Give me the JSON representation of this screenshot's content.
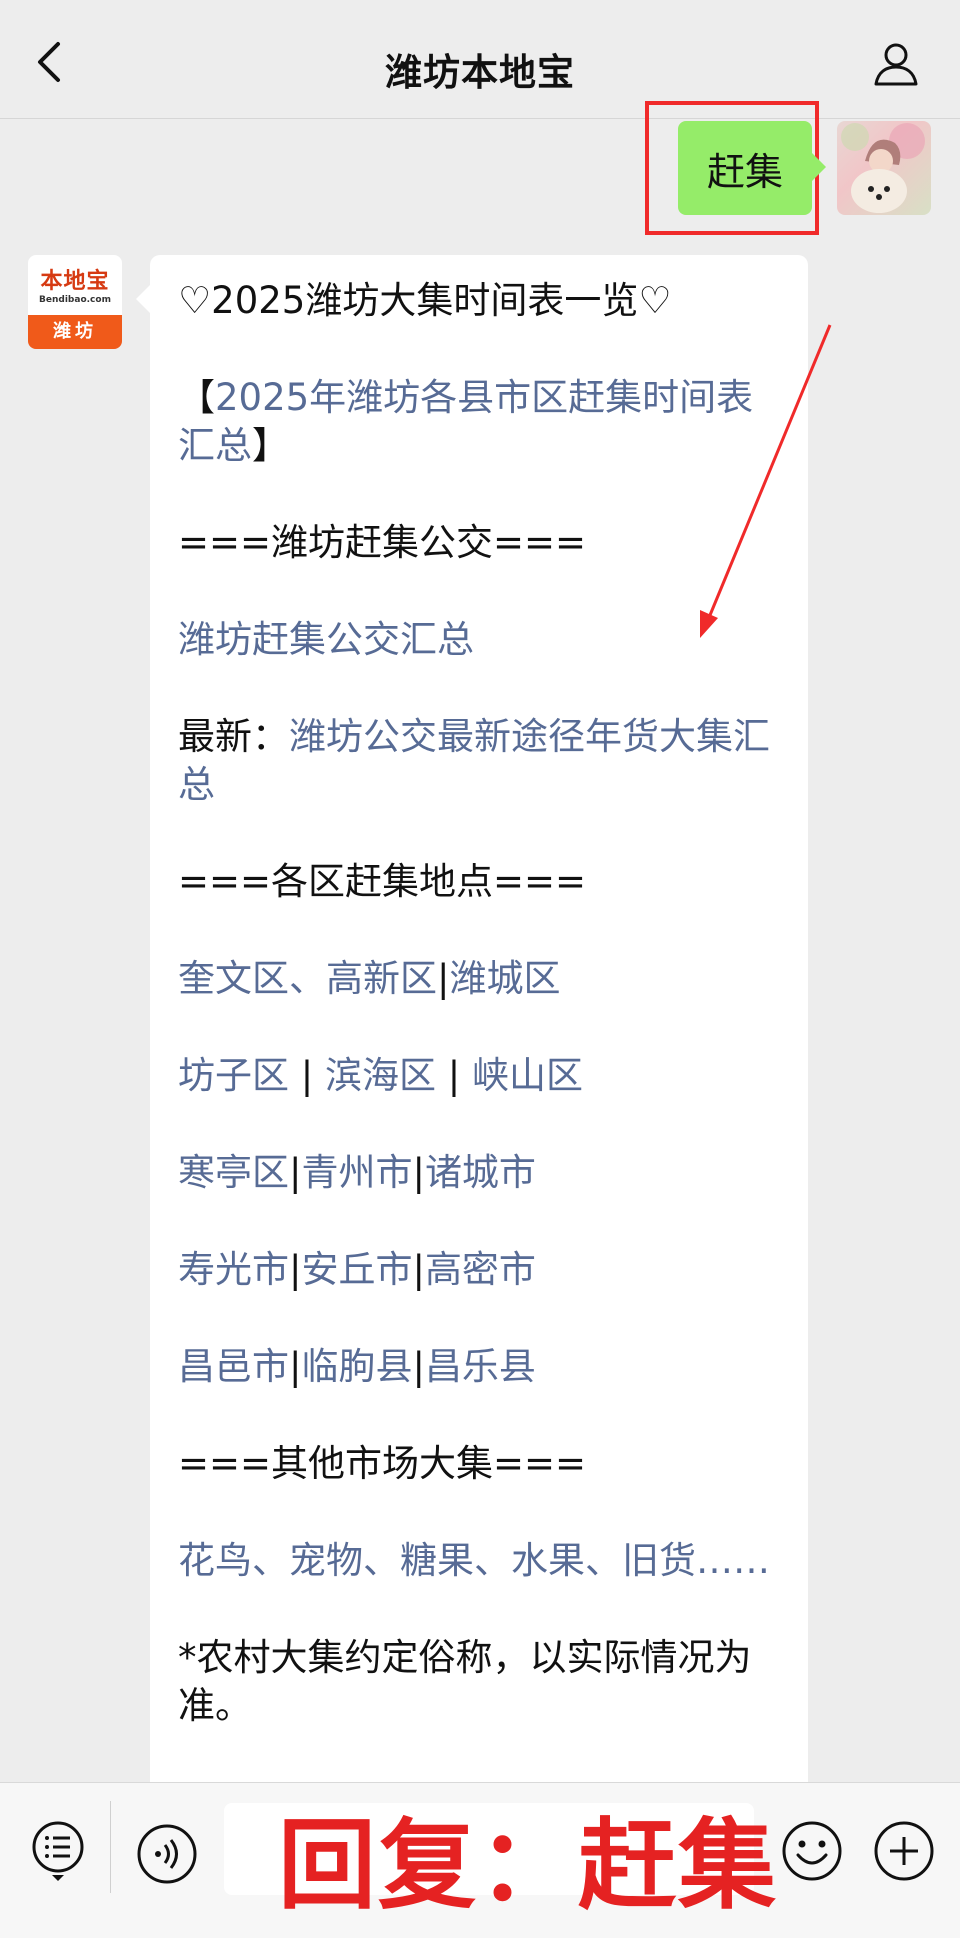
{
  "header": {
    "title": "潍坊本地宝",
    "back_icon": "chevron-left-icon",
    "profile_icon": "user-icon"
  },
  "user_message": {
    "text": "赶集"
  },
  "bot_avatar": {
    "logo_text": "本地宝",
    "domain": "Bendibao.com",
    "city": "潍坊"
  },
  "bot_message": {
    "title": "♡2025潍坊大集时间表一览♡",
    "summary_open": "【",
    "summary_link": "2025年潍坊各县市区赶集时间表汇总",
    "summary_close": "】",
    "section_bus": "===潍坊赶集公交===",
    "bus_link": "潍坊赶集公交汇总",
    "latest_label": "最新：",
    "latest_link": "潍坊公交最新途径年货大集汇总",
    "section_districts": "===各区赶集地点===",
    "districts_rows": [
      {
        "a": "奎文区、高新区",
        "sep1": "|",
        "b": "潍城区"
      },
      {
        "a": "坊子区",
        "sep1": " | ",
        "b": "滨海区",
        "sep2": " | ",
        "c": "峡山区"
      },
      {
        "a": "寒亭区",
        "sep1": "|",
        "b": "青州市",
        "sep2": "|",
        "c": "诸城市"
      },
      {
        "a": "寿光市",
        "sep1": "|",
        "b": "安丘市",
        "sep2": "|",
        "c": "高密市"
      },
      {
        "a": "昌邑市",
        "sep1": "|",
        "b": "临朐县",
        "sep2": "|",
        "c": "昌乐县"
      }
    ],
    "section_other": "===其他市场大集===",
    "other_link": "花鸟、宠物、糖果、水果、旧货……",
    "note": "*农村大集约定俗称，以实际情况为准。"
  },
  "bottom_bar": {
    "menu_icon": "list-menu-icon",
    "voice_icon": "voice-icon",
    "emoji_icon": "emoji-icon",
    "plus_icon": "plus-icon",
    "overlay_text": "回复：赶集"
  },
  "colors": {
    "link": "#576b95",
    "user_bubble": "#95ec69",
    "highlight_red": "#f02a2a",
    "brand_orange": "#f05a1a"
  }
}
